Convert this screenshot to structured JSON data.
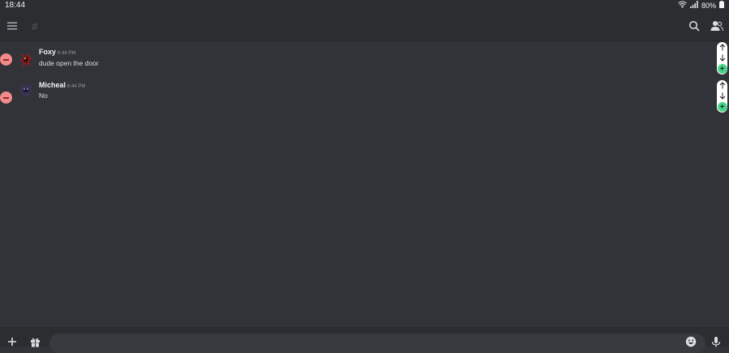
{
  "status_bar": {
    "time": "18:44",
    "battery": "80%"
  },
  "header": {
    "channel_symbol": "#"
  },
  "messages": [
    {
      "author": "Foxy",
      "timestamp": "6:44 PM",
      "content": "dude open the door"
    },
    {
      "author": "Micheal",
      "timestamp": "6:44 PM",
      "content": "No"
    }
  ],
  "composer": {
    "placeholder": ""
  },
  "colors": {
    "background": "#313338",
    "bar": "#2b2d31",
    "remove": "#f38b8b",
    "add": "#4bd28a"
  },
  "icons": [
    "wifi-icon",
    "signal-icon",
    "battery-icon",
    "menu-icon",
    "search-icon",
    "members-icon",
    "arrow-up-icon",
    "arrow-down-icon",
    "plus-icon",
    "gift-icon",
    "emoji-icon",
    "microphone-icon"
  ]
}
